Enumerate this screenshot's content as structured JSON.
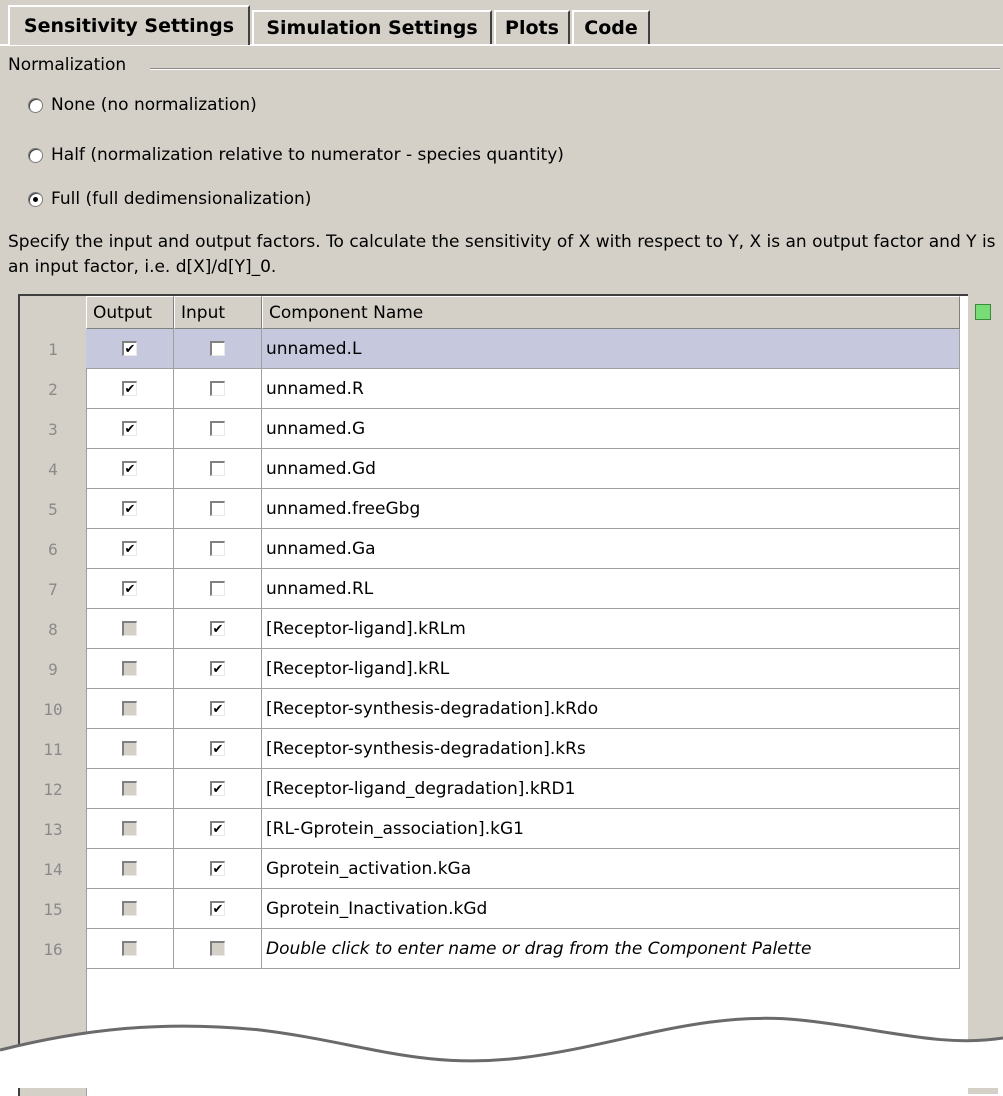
{
  "tabs": [
    {
      "label": "Sensitivity Settings"
    },
    {
      "label": "Simulation Settings"
    },
    {
      "label": "Plots"
    },
    {
      "label": "Code"
    }
  ],
  "normalization": {
    "group_label": "Normalization",
    "options": [
      {
        "label": "None (no normalization)",
        "checked": false
      },
      {
        "label": "Half (normalization relative to numerator - species quantity)",
        "checked": false
      },
      {
        "label": "Full (full dedimensionalization)",
        "checked": true
      }
    ]
  },
  "description": "Specify the input and output factors. To calculate the sensitivity of X with respect to Y, X is an output factor and Y is an input factor, i.e. d[X]/d[Y]_0.",
  "table": {
    "headers": {
      "output": "Output",
      "input": "Input",
      "name": "Component Name"
    },
    "rows": [
      {
        "num": "1",
        "output": true,
        "input": false,
        "name": "unnamed.L"
      },
      {
        "num": "2",
        "output": true,
        "input": false,
        "name": "unnamed.R"
      },
      {
        "num": "3",
        "output": true,
        "input": false,
        "name": "unnamed.G"
      },
      {
        "num": "4",
        "output": true,
        "input": false,
        "name": "unnamed.Gd"
      },
      {
        "num": "5",
        "output": true,
        "input": false,
        "name": "unnamed.freeGbg"
      },
      {
        "num": "6",
        "output": true,
        "input": false,
        "name": "unnamed.Ga"
      },
      {
        "num": "7",
        "output": true,
        "input": false,
        "name": "unnamed.RL"
      },
      {
        "num": "8",
        "output": false,
        "input": true,
        "name": "[Receptor-ligand].kRLm"
      },
      {
        "num": "9",
        "output": false,
        "input": true,
        "name": "[Receptor-ligand].kRL"
      },
      {
        "num": "10",
        "output": false,
        "input": true,
        "name": "[Receptor-synthesis-degradation].kRdo"
      },
      {
        "num": "11",
        "output": false,
        "input": true,
        "name": "[Receptor-synthesis-degradation].kRs"
      },
      {
        "num": "12",
        "output": false,
        "input": true,
        "name": "[Receptor-ligand_degradation].kRD1"
      },
      {
        "num": "13",
        "output": false,
        "input": true,
        "name": "[RL-Gprotein_association].kG1"
      },
      {
        "num": "14",
        "output": false,
        "input": true,
        "name": "Gprotein_activation.kGa"
      },
      {
        "num": "15",
        "output": false,
        "input": true,
        "name": "Gprotein_Inactivation.kGd"
      },
      {
        "num": "16",
        "output": false,
        "input": false,
        "name": "Double click to enter name or drag from the Component Palette"
      }
    ],
    "selected_row": 1
  },
  "colors": {
    "panel": "#d4d0c8",
    "selection": "#c6c8de",
    "indicator": "#77dd77"
  }
}
